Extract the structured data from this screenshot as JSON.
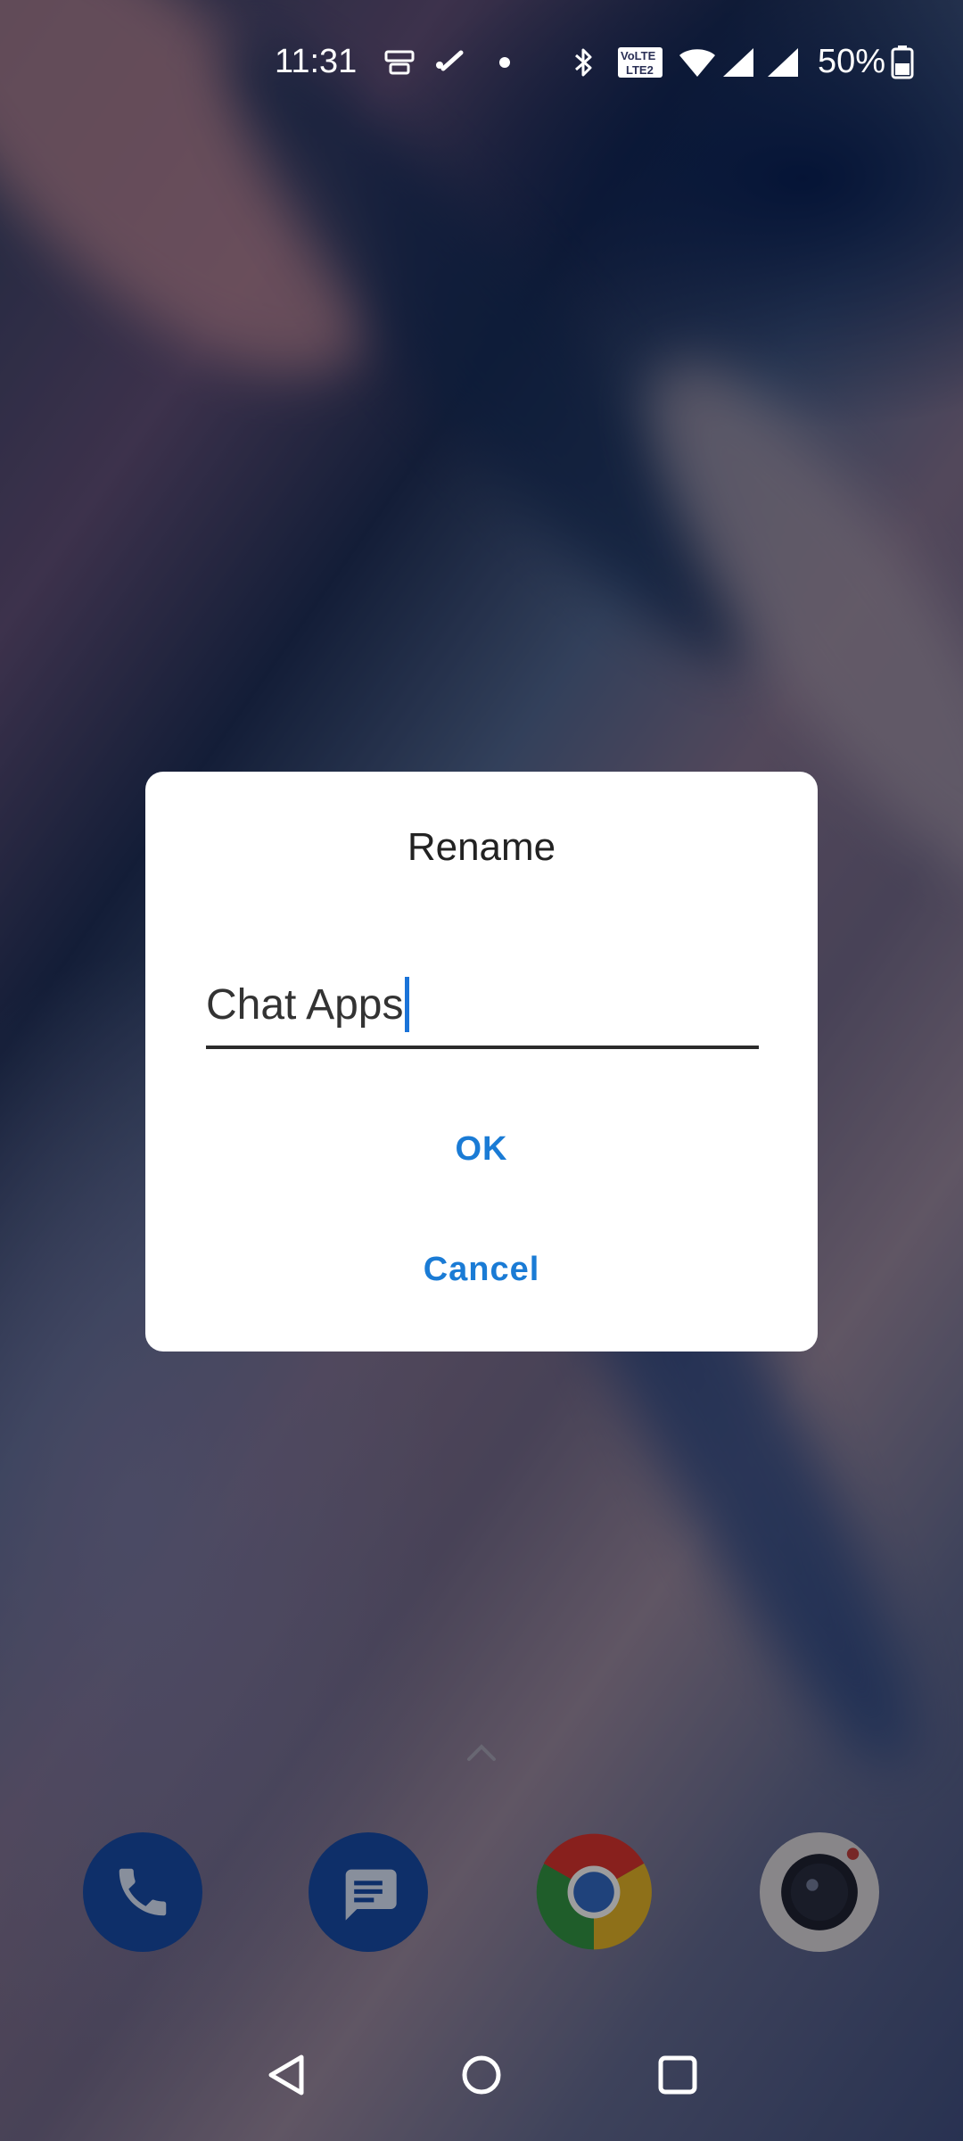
{
  "status_bar": {
    "time": "11:31",
    "battery_percent": "50%",
    "icons": [
      "network-monitor-icon",
      "missed-call-icon",
      "notification-dot-icon",
      "bluetooth-icon",
      "volte-icon",
      "wifi-icon",
      "signal-icon",
      "signal-icon",
      "battery-icon"
    ],
    "battery_level": 0.5
  },
  "dialog": {
    "title": "Rename",
    "input_value": "Chat Apps",
    "ok_label": "OK",
    "cancel_label": "Cancel"
  },
  "dock": {
    "apps": [
      "phone-icon",
      "messages-icon",
      "chrome-icon",
      "camera-icon"
    ]
  },
  "navigation": {
    "buttons": [
      "back-icon",
      "home-icon",
      "recents-icon"
    ]
  },
  "colors": {
    "accent": "#1a7bd5",
    "dialog_bg": "#ffffff",
    "dock_blue": "#16469b"
  }
}
